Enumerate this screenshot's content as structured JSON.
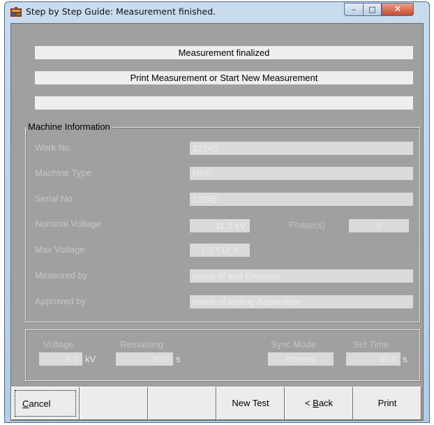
{
  "window": {
    "title": "Step by Step Guide: Measurement finished."
  },
  "window_controls": {
    "minimize": "–",
    "maximize": "□",
    "close": "✕"
  },
  "messages": [
    "Measurement finalized",
    "Print Measurement or Start New Measurement",
    ""
  ],
  "machine_info": {
    "title": "Machine Information",
    "work_no": {
      "label": "Work No.",
      "value": "12345"
    },
    "machine_type": {
      "label": "Machine Type",
      "value": "HXR"
    },
    "serial_no": {
      "label": "Serial No.",
      "value": "12345"
    },
    "nominal_voltage": {
      "label": "Nominal Voltage",
      "value": "11.0 kV"
    },
    "phases": {
      "label": "Phase(s)",
      "value": "V"
    },
    "max_voltage": {
      "label": "Max Voltage",
      "value": "1.2 * U_n"
    },
    "measured_by": {
      "label": "Measured by",
      "value": "name of test Engineer"
    },
    "approved_by": {
      "label": "Approved by",
      "value": "name of testing Supervisor"
    }
  },
  "status": {
    "voltage": {
      "label": "Voltage",
      "value": "5.0",
      "unit": "kV"
    },
    "remaining": {
      "label": "Remaining",
      "value": "30.0",
      "unit": "s"
    },
    "sync_mode": {
      "label": "Sync Mode",
      "value": "Normal"
    },
    "set_time": {
      "label": "Set Time",
      "value": "30.0",
      "unit": "s"
    }
  },
  "buttons": {
    "cancel": {
      "mnemonic": "C",
      "rest": "ancel"
    },
    "new_test": "New Test",
    "back": {
      "prefix": "< ",
      "mnemonic": "B",
      "rest": "ack"
    },
    "print": "Print"
  }
}
